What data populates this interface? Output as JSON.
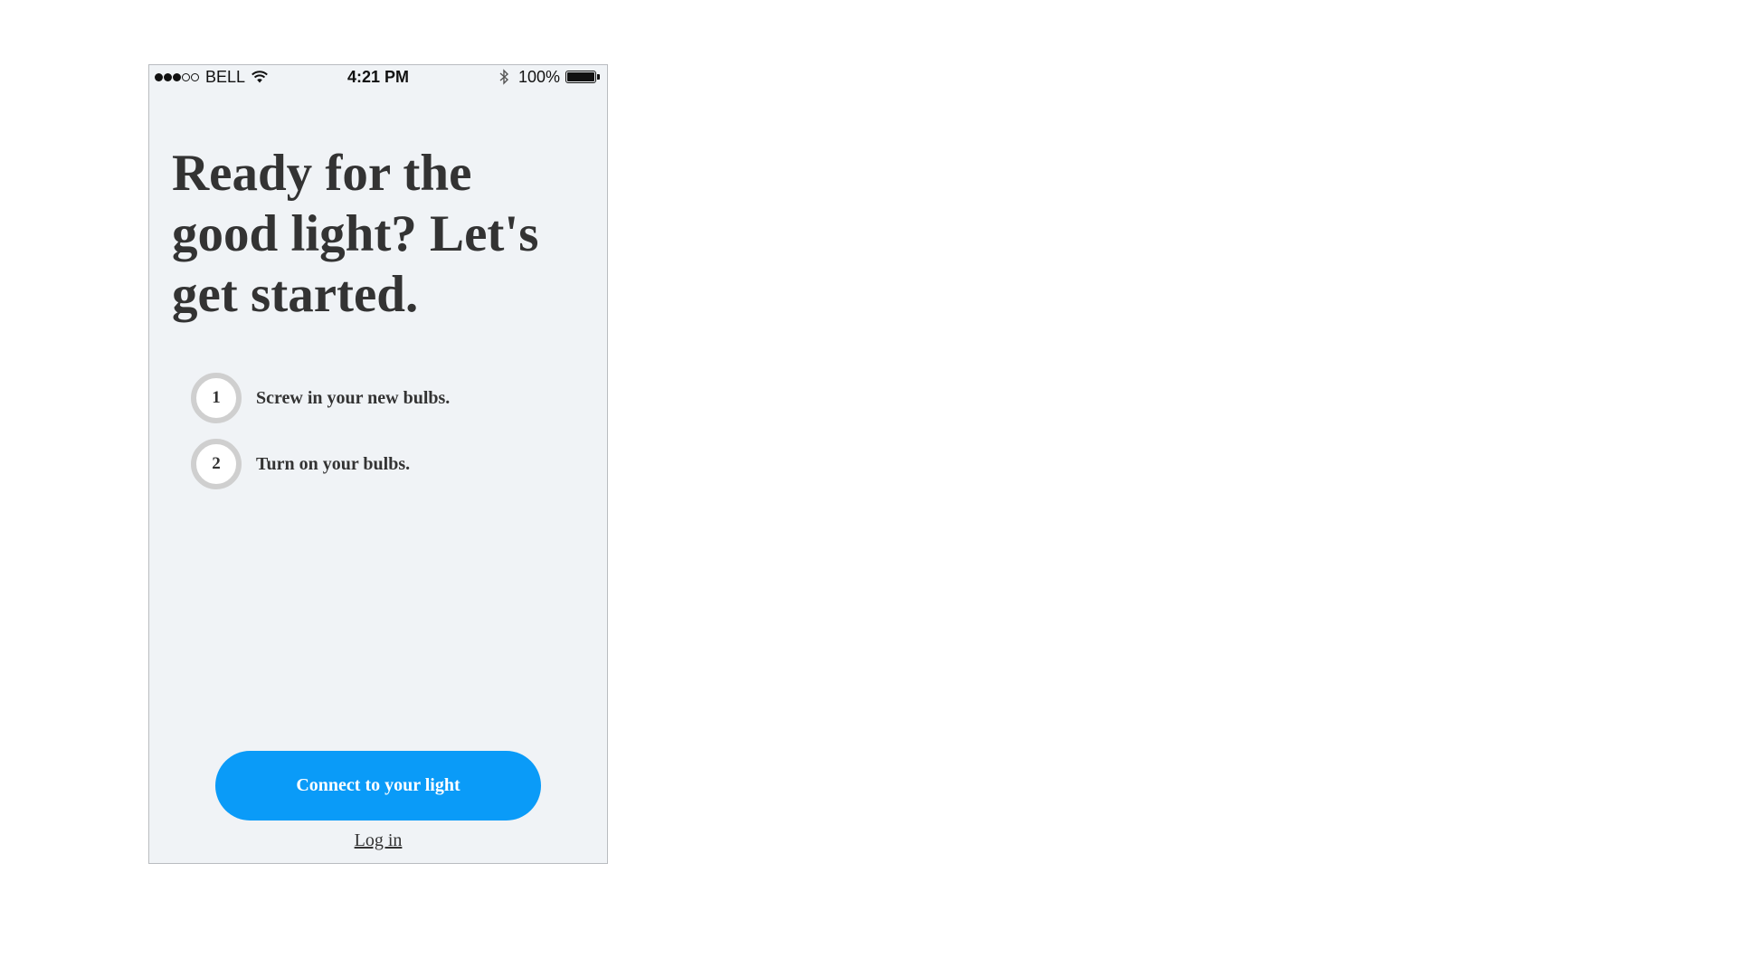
{
  "status_bar": {
    "signal": {
      "filled": 3,
      "total": 5
    },
    "carrier": "BELL",
    "wifi_icon": "wifi-icon",
    "time": "4:21 PM",
    "bluetooth_icon": "bluetooth-icon",
    "battery_percent": "100%",
    "battery_level": 1.0
  },
  "onboarding": {
    "headline": "Ready for the good light? Let's get started.",
    "steps": [
      {
        "number": "1",
        "text": "Screw in your new bulbs."
      },
      {
        "number": "2",
        "text": "Turn on your bulbs."
      }
    ],
    "primary_button_label": "Connect to your light",
    "login_link_label": "Log in"
  },
  "colors": {
    "background": "#f0f3f6",
    "accent": "#0a9bf8",
    "text": "#333333",
    "step_ring": "#cfcfcf"
  }
}
